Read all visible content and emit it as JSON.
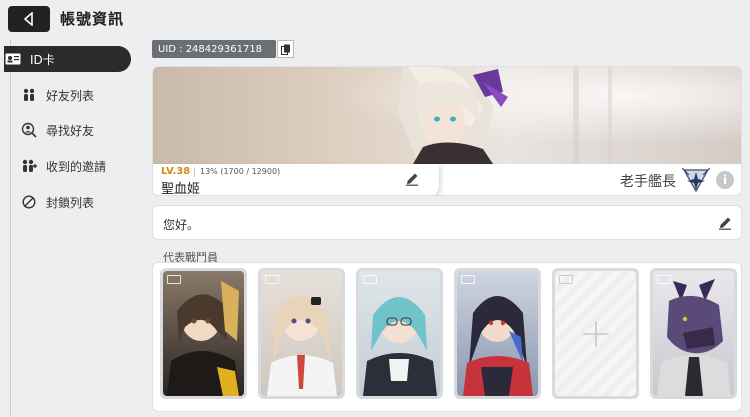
{
  "header": {
    "title": "帳號資訊"
  },
  "sidebar": {
    "items": [
      {
        "label": "ID卡",
        "icon": "id-card-icon",
        "active": true
      },
      {
        "label": "好友列表",
        "icon": "friends-icon",
        "active": false
      },
      {
        "label": "尋找好友",
        "icon": "find-friend-icon",
        "active": false
      },
      {
        "label": "收到的邀請",
        "icon": "invitations-icon",
        "active": false
      },
      {
        "label": "封鎖列表",
        "icon": "block-icon",
        "active": false
      }
    ]
  },
  "profile": {
    "uid": "UID : 248429361718",
    "level": "LV.38",
    "exp": "13% (1700 / 12900)",
    "exp_progress": 0.13,
    "name": "聖血姬",
    "rank_title": "老手艦長",
    "greeting": "您好。"
  },
  "representatives": {
    "title": "代表戰鬥員",
    "slots": [
      {
        "state": "filled",
        "palette": [
          "#4a3a2e",
          "#d9b15a"
        ]
      },
      {
        "state": "filled",
        "palette": [
          "#e8d4b8",
          "#c94a3a"
        ]
      },
      {
        "state": "filled",
        "palette": [
          "#6fc3c9",
          "#2b2f3a"
        ]
      },
      {
        "state": "filled",
        "palette": [
          "#2a2a3a",
          "#c8323a"
        ]
      },
      {
        "state": "empty",
        "palette": [
          "#eeeff1",
          "#f5f6f7"
        ]
      },
      {
        "state": "filled",
        "palette": [
          "#5a4a7a",
          "#dcdcdc"
        ]
      }
    ]
  },
  "colors": {
    "accent_level": "#d08a1a",
    "sidebar_active": "#2b2b2b"
  }
}
